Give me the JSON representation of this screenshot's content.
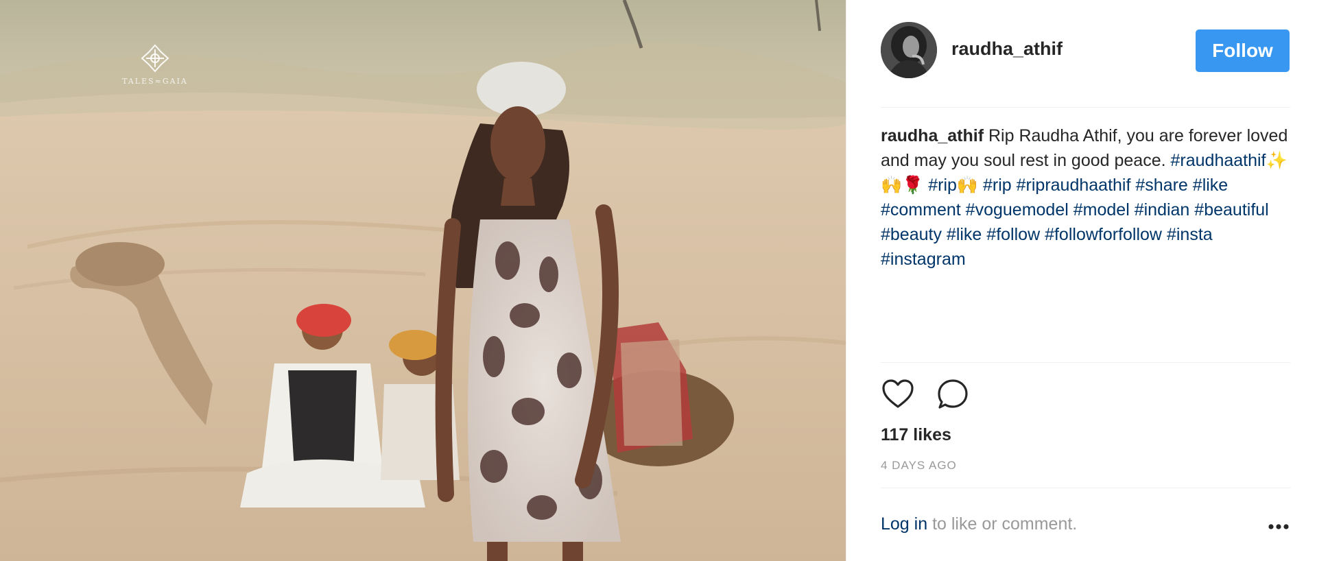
{
  "post": {
    "username": "raudha_athif",
    "follow_label": "Follow",
    "caption": {
      "username": "raudha_athif",
      "text": "Rip Raudha Athif, you are forever loved and may you soul rest in good peace.",
      "hashtags": [
        "#raudhaathif✨🙌🌹",
        "#rip🙌",
        "#rip",
        "#ripraudhaathif",
        "#share",
        "#like",
        "#comment",
        "#voguemodel",
        "#model",
        "#indian",
        "#beautiful",
        "#beauty",
        "#like",
        "#follow",
        "#followforfollow",
        "#insta",
        "#instagram"
      ]
    },
    "likes": "117 likes",
    "time_ago": "4 DAYS AGO"
  },
  "footer": {
    "login_label": "Log in",
    "login_suffix": " to like or comment."
  },
  "watermark": {
    "text": "TALES≈GAIA"
  },
  "icons": {
    "like": "heart-icon",
    "comment": "comment-icon",
    "more": "more-options-icon"
  },
  "colors": {
    "follow_button": "#3897f0",
    "hashtag": "#003569",
    "text": "#262626",
    "muted": "#999999"
  }
}
